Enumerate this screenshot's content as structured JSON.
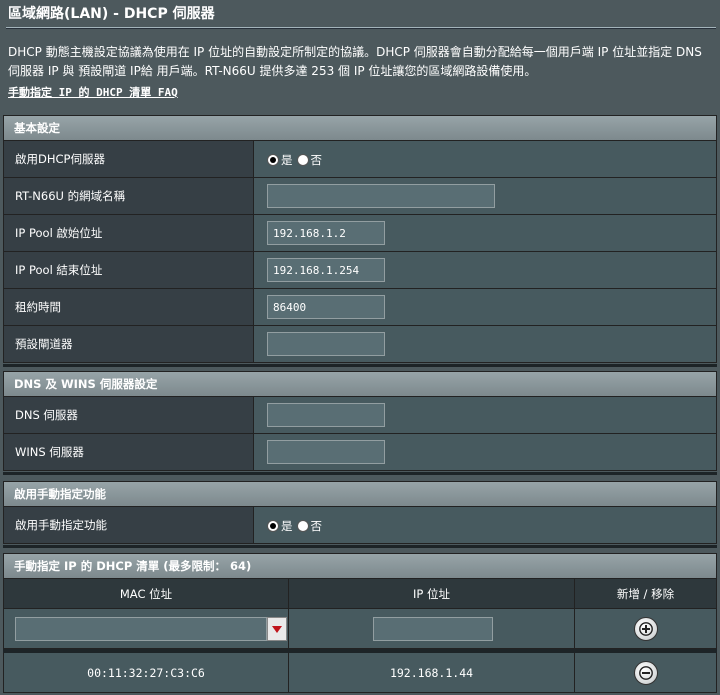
{
  "page": {
    "title": "區域網路(LAN) - DHCP 伺服器",
    "description": "DHCP 動態主機設定協議為使用在 IP 位址的自動設定所制定的協議。DHCP 伺服器會自動分配給每一個用戶端 IP 位址並指定 DNS 伺服器 IP 與 預設閘道 IP給 用戶端。RT-N66U 提供多達 253 個 IP 位址讓您的區域網路設備使用。",
    "faq_link": "手動指定 IP 的 DHCP 清單 FAQ"
  },
  "basic": {
    "header": "基本設定",
    "enable_dhcp": {
      "label": "啟用DHCP伺服器",
      "yes": "是",
      "no": "否",
      "selected": "yes"
    },
    "domain_name": {
      "label": "RT-N66U 的網域名稱",
      "value": ""
    },
    "pool_start": {
      "label": "IP Pool 啟始位址",
      "value": "192.168.1.2"
    },
    "pool_end": {
      "label": "IP Pool 結束位址",
      "value": "192.168.1.254"
    },
    "lease_time": {
      "label": "租約時間",
      "value": "86400"
    },
    "gateway": {
      "label": "預設閘道器",
      "value": ""
    }
  },
  "dns_wins": {
    "header": "DNS 及 WINS 伺服器設定",
    "dns": {
      "label": "DNS 伺服器",
      "value": ""
    },
    "wins": {
      "label": "WINS 伺服器",
      "value": ""
    }
  },
  "manual": {
    "header": "啟用手動指定功能",
    "enable": {
      "label": "啟用手動指定功能",
      "yes": "是",
      "no": "否",
      "selected": "yes"
    }
  },
  "list": {
    "header": "手動指定 IP 的 DHCP 清單 (最多限制： 64)",
    "columns": [
      "MAC 位址",
      "IP 位址",
      "新增 / 移除"
    ],
    "new_entry": {
      "mac": "",
      "ip": ""
    },
    "entries": [
      {
        "mac": "00:11:32:27:C3:C6",
        "ip": "192.168.1.44"
      }
    ]
  }
}
